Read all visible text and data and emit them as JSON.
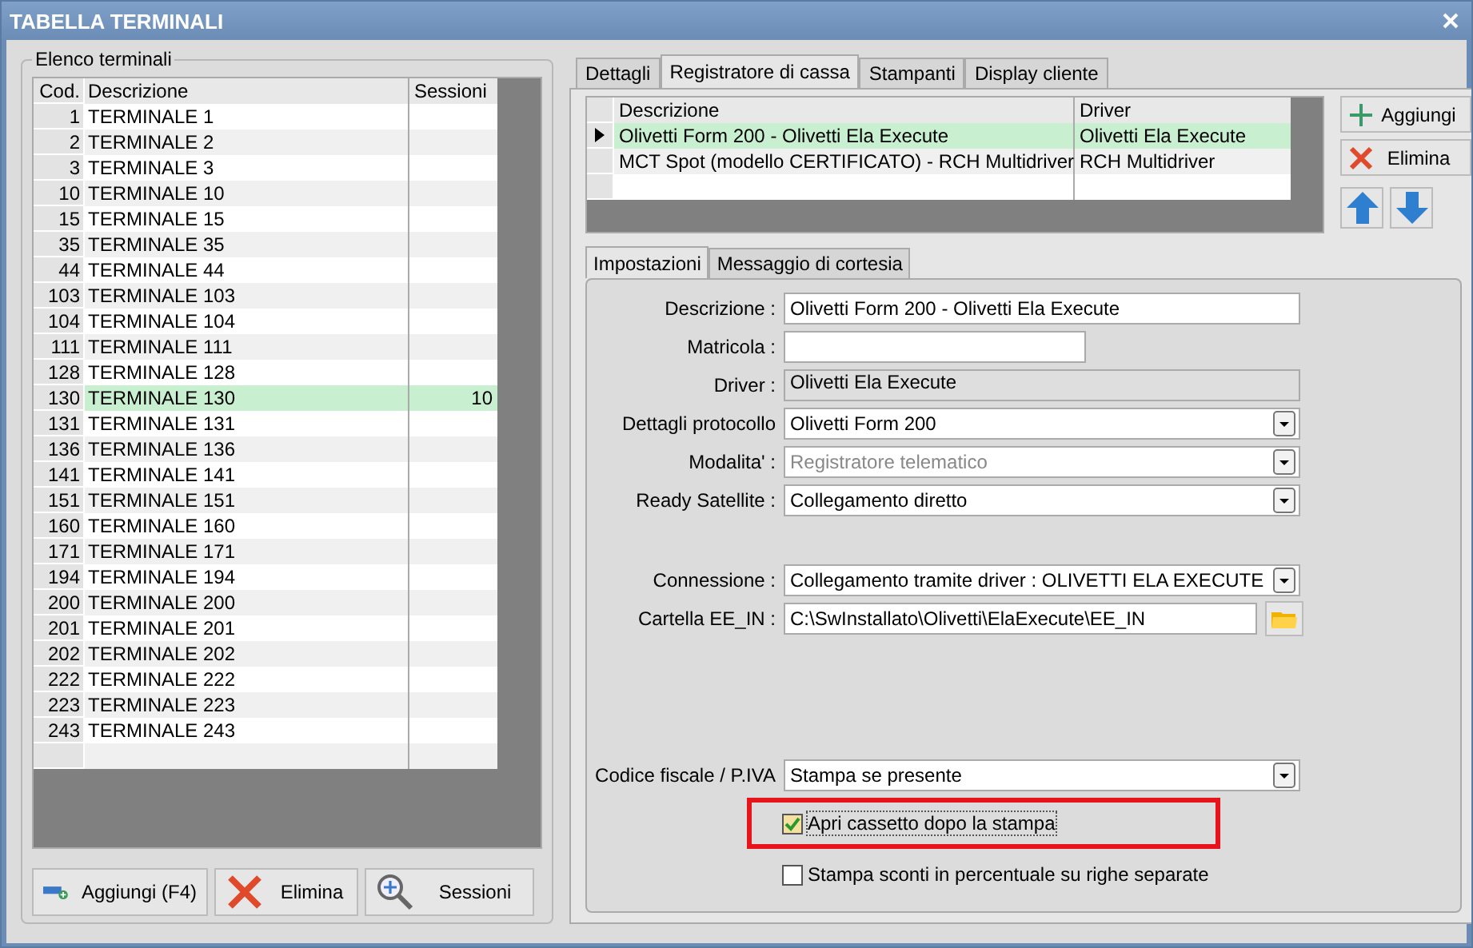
{
  "window": {
    "title": "TABELLA TERMINALI"
  },
  "terminals": {
    "group_title": "Elenco terminali",
    "columns": [
      "Cod.",
      "Descrizione",
      "Sessioni"
    ],
    "rows": [
      {
        "code": "1",
        "description": "TERMINALE 1",
        "sessions": "",
        "selected": false
      },
      {
        "code": "2",
        "description": "TERMINALE 2",
        "sessions": "",
        "selected": false
      },
      {
        "code": "3",
        "description": "TERMINALE 3",
        "sessions": "",
        "selected": false
      },
      {
        "code": "10",
        "description": "TERMINALE 10",
        "sessions": "",
        "selected": false
      },
      {
        "code": "15",
        "description": "TERMINALE 15",
        "sessions": "",
        "selected": false
      },
      {
        "code": "35",
        "description": "TERMINALE 35",
        "sessions": "",
        "selected": false
      },
      {
        "code": "44",
        "description": "TERMINALE 44",
        "sessions": "",
        "selected": false
      },
      {
        "code": "103",
        "description": "TERMINALE 103",
        "sessions": "",
        "selected": false
      },
      {
        "code": "104",
        "description": "TERMINALE 104",
        "sessions": "",
        "selected": false
      },
      {
        "code": "111",
        "description": "TERMINALE 111",
        "sessions": "",
        "selected": false
      },
      {
        "code": "128",
        "description": "TERMINALE 128",
        "sessions": "",
        "selected": false
      },
      {
        "code": "130",
        "description": "TERMINALE 130",
        "sessions": "10",
        "selected": true
      },
      {
        "code": "131",
        "description": "TERMINALE 131",
        "sessions": "",
        "selected": false
      },
      {
        "code": "136",
        "description": "TERMINALE 136",
        "sessions": "",
        "selected": false
      },
      {
        "code": "141",
        "description": "TERMINALE 141",
        "sessions": "",
        "selected": false
      },
      {
        "code": "151",
        "description": "TERMINALE 151",
        "sessions": "",
        "selected": false
      },
      {
        "code": "160",
        "description": "TERMINALE 160",
        "sessions": "",
        "selected": false
      },
      {
        "code": "171",
        "description": "TERMINALE 171",
        "sessions": "",
        "selected": false
      },
      {
        "code": "194",
        "description": "TERMINALE 194",
        "sessions": "",
        "selected": false
      },
      {
        "code": "200",
        "description": "TERMINALE 200",
        "sessions": "",
        "selected": false
      },
      {
        "code": "201",
        "description": "TERMINALE 201",
        "sessions": "",
        "selected": false
      },
      {
        "code": "202",
        "description": "TERMINALE 202",
        "sessions": "",
        "selected": false
      },
      {
        "code": "222",
        "description": "TERMINALE 222",
        "sessions": "",
        "selected": false
      },
      {
        "code": "223",
        "description": "TERMINALE 223",
        "sessions": "",
        "selected": false
      },
      {
        "code": "243",
        "description": "TERMINALE 243",
        "sessions": "",
        "selected": false
      }
    ],
    "buttons": [
      {
        "kind": "add",
        "label": "Aggiungi (F4)"
      },
      {
        "kind": "delete",
        "label": "Elimina"
      },
      {
        "kind": "search",
        "label": "Sessioni"
      }
    ]
  },
  "tabs": [
    {
      "label": "Dettagli",
      "selected": false
    },
    {
      "label": "Registratore di cassa",
      "selected": true
    },
    {
      "label": "Stampanti",
      "selected": false
    },
    {
      "label": "Display cliente",
      "selected": false
    }
  ],
  "registers": {
    "columns": [
      "Descrizione",
      "Driver"
    ],
    "rows": [
      {
        "description": "Olivetti Form 200 - Olivetti Ela Execute",
        "driver": "Olivetti Ela Execute",
        "selected": true
      },
      {
        "description": "MCT Spot (modello CERTIFICATO) - RCH Multidriver",
        "driver": "RCH Multidriver",
        "selected": false
      }
    ],
    "buttons": [
      {
        "kind": "add",
        "label": "Aggiungi"
      },
      {
        "kind": "delete",
        "label": "Elimina"
      },
      {
        "kind": "up"
      },
      {
        "kind": "down"
      }
    ]
  },
  "subtabs": [
    {
      "label": "Impostazioni",
      "selected": true
    },
    {
      "label": "Messaggio di cortesia",
      "selected": false
    }
  ],
  "fields": [
    {
      "label": "Descrizione :",
      "kind": "text",
      "value": "Olivetti Form 200 - Olivetti Ela Execute"
    },
    {
      "label": "Matricola :",
      "kind": "short"
    },
    {
      "label": "Driver :",
      "kind": "readonly",
      "value": "Olivetti Ela Execute"
    },
    {
      "label": "Dettagli protocollo",
      "kind": "select",
      "disabled": false,
      "value": "Olivetti Form 200"
    },
    {
      "label": "Modalita' :",
      "kind": "select",
      "disabled": true,
      "value": "Registratore telematico"
    },
    {
      "label": "Ready Satellite :",
      "kind": "select",
      "disabled": false,
      "value": "Collegamento diretto"
    },
    {
      "kind": "spacer"
    },
    {
      "label": "Connessione :",
      "kind": "select",
      "disabled": false,
      "value": "Collegamento tramite driver : OLIVETTI ELA EXECUTE"
    },
    {
      "label": "Cartella EE_IN :",
      "kind": "path",
      "value": "C:\\SwInstallato\\Olivetti\\ElaExecute\\EE_IN"
    },
    {
      "kind": "wide_spacer"
    },
    {
      "label": "Codice fiscale / P.IVA",
      "kind": "select",
      "disabled": false,
      "value": "Stampa se presente"
    }
  ],
  "checkboxes": [
    {
      "label": "Apri cassetto dopo la stampa",
      "checked": true,
      "highlighted": true
    },
    {
      "label": "Stampa sconti in percentuale su righe separate",
      "checked": false,
      "highlighted": false
    }
  ]
}
